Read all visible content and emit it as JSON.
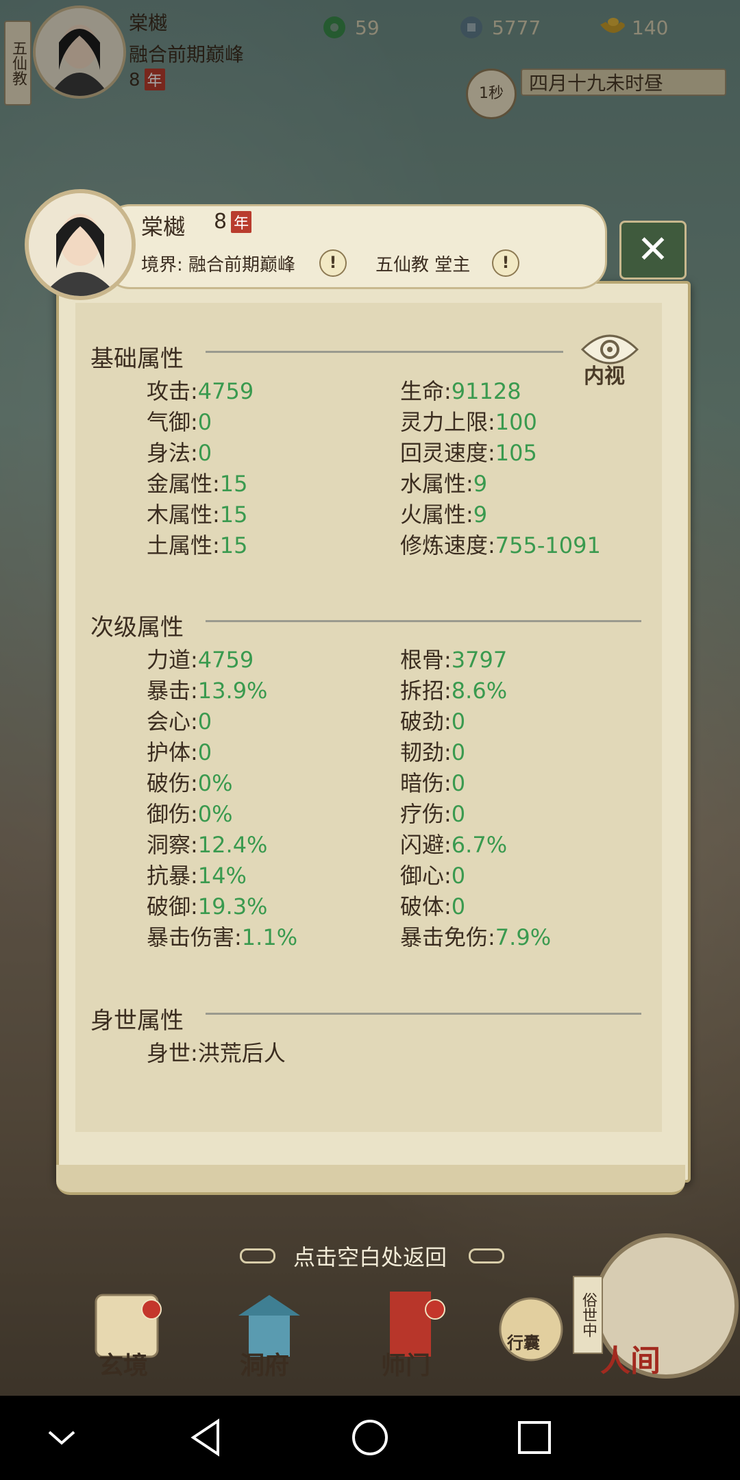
{
  "top": {
    "sect_tag": "五仙教",
    "name": "棠樾",
    "realm": "融合前期巅峰",
    "age": "8",
    "age_unit": "年",
    "resources": [
      {
        "icon": "jade-icon",
        "value": "59"
      },
      {
        "icon": "coin-icon",
        "value": "5777"
      },
      {
        "icon": "ingot-icon",
        "value": "140"
      }
    ],
    "time_speed": "1秒",
    "date_text": "四月十九未时昼"
  },
  "dialog": {
    "name": "棠樾",
    "age": "8",
    "age_unit": "年",
    "realm_text": "境界: 融合前期巅峰",
    "sect_text": "五仙教 堂主",
    "inner_view_label": "内视"
  },
  "basic": {
    "title": "基础属性",
    "left": [
      {
        "label": "攻击:",
        "value": "4759"
      },
      {
        "label": "气御:",
        "value": "0"
      },
      {
        "label": "身法:",
        "value": "0"
      },
      {
        "label": "金属性:",
        "value": "15"
      },
      {
        "label": "木属性:",
        "value": "15"
      },
      {
        "label": "土属性:",
        "value": "15"
      }
    ],
    "right": [
      {
        "label": "生命:",
        "value": "91128"
      },
      {
        "label": "灵力上限:",
        "value": "100"
      },
      {
        "label": "回灵速度:",
        "value": "105"
      },
      {
        "label": "水属性:",
        "value": "9"
      },
      {
        "label": "火属性:",
        "value": "9"
      },
      {
        "label": "修炼速度:",
        "value": "755-1091"
      }
    ]
  },
  "secondary": {
    "title": "次级属性",
    "left": [
      {
        "label": "力道:",
        "value": "4759"
      },
      {
        "label": "暴击:",
        "value": "13.9%"
      },
      {
        "label": "会心:",
        "value": "0"
      },
      {
        "label": "护体:",
        "value": "0"
      },
      {
        "label": "破伤:",
        "value": "0%"
      },
      {
        "label": "御伤:",
        "value": "0%"
      },
      {
        "label": "洞察:",
        "value": "12.4%"
      },
      {
        "label": "抗暴:",
        "value": "14%"
      },
      {
        "label": "破御:",
        "value": "19.3%"
      },
      {
        "label": "暴击伤害:",
        "value": "1.1%"
      }
    ],
    "right": [
      {
        "label": "根骨:",
        "value": "3797"
      },
      {
        "label": "拆招:",
        "value": "8.6%"
      },
      {
        "label": "破劲:",
        "value": "0"
      },
      {
        "label": "韧劲:",
        "value": "0"
      },
      {
        "label": "暗伤:",
        "value": "0"
      },
      {
        "label": "疗伤:",
        "value": "0"
      },
      {
        "label": "闪避:",
        "value": "6.7%"
      },
      {
        "label": "御心:",
        "value": "0"
      },
      {
        "label": "破体:",
        "value": "0"
      },
      {
        "label": "暴击免伤:",
        "value": "7.9%"
      }
    ]
  },
  "origin": {
    "title": "身世属性",
    "label": "身世:",
    "value": "洪荒后人"
  },
  "return_hint": "点击空白处返回",
  "bottom_nav": [
    {
      "label": "玄境"
    },
    {
      "label": "洞府"
    },
    {
      "label": "师门"
    },
    {
      "label": "行囊"
    }
  ],
  "human_world": {
    "label": "人间",
    "tag": "俗世中"
  },
  "colors": {
    "value_green": "#3a9a4f",
    "text_dark": "#3b2d20",
    "badge_red": "#b93c2d"
  }
}
